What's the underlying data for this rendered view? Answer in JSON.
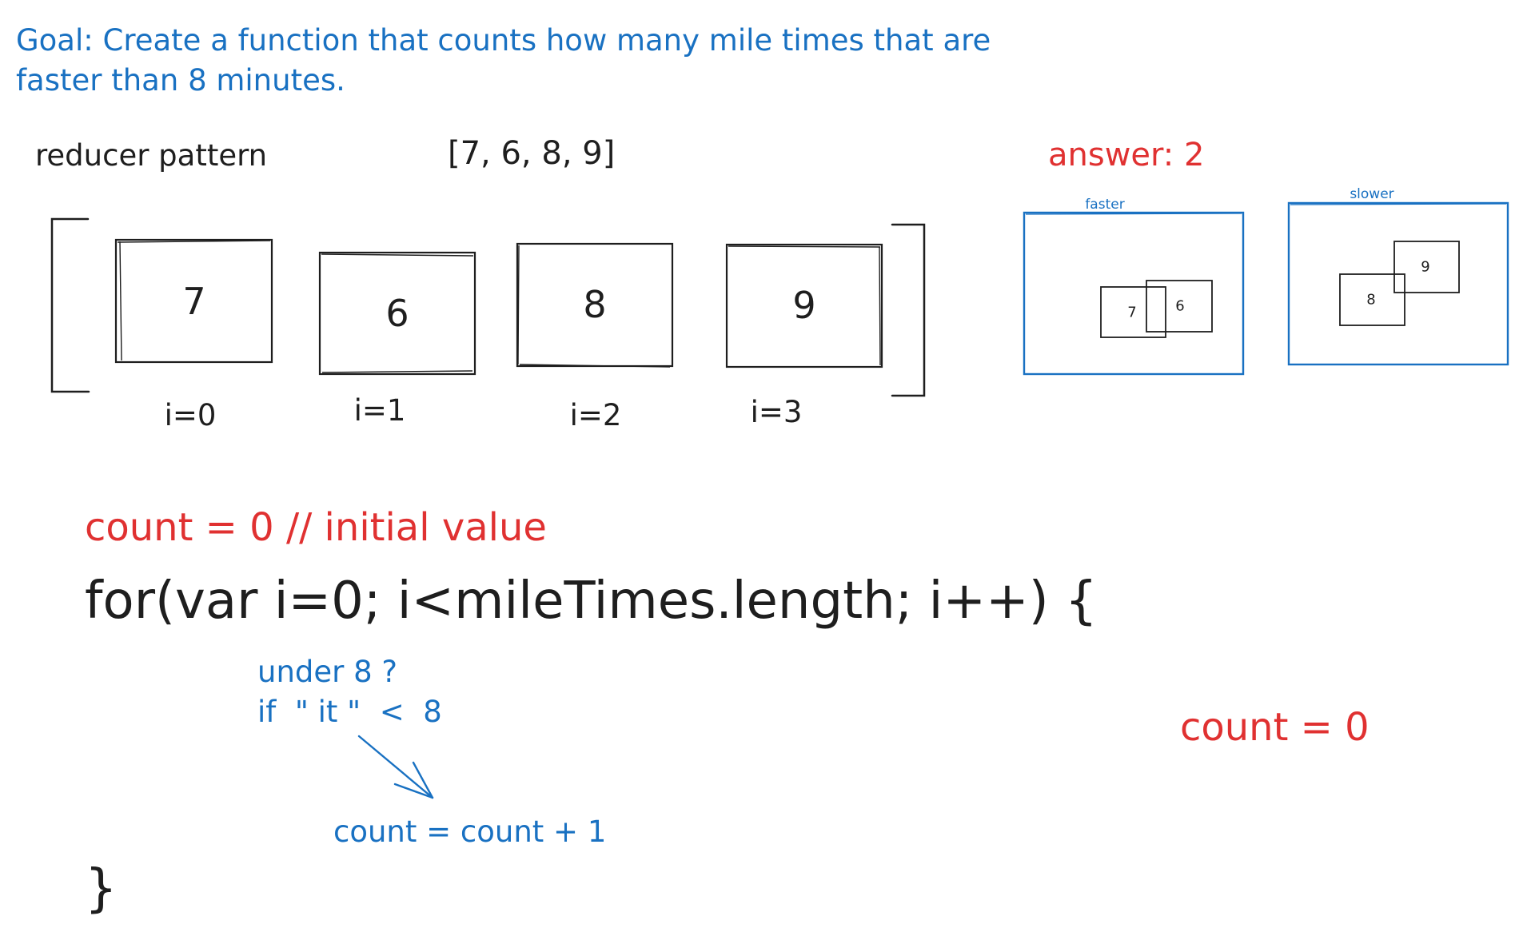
{
  "goal_text": "Goal: Create a function that counts how many mile times that are faster than 8 minutes.",
  "pattern_label": "reducer pattern",
  "array_literal": "[7, 6, 8, 9]",
  "answer_label": "answer: 2",
  "array_items": [
    {
      "value": "7",
      "index_label": "i=0"
    },
    {
      "value": "6",
      "index_label": "i=1"
    },
    {
      "value": "8",
      "index_label": "i=2"
    },
    {
      "value": "9",
      "index_label": "i=3"
    }
  ],
  "groups": {
    "faster": {
      "title": "faster",
      "items": [
        "7",
        "6"
      ]
    },
    "slower": {
      "title": "slower",
      "items": [
        "8",
        "9"
      ]
    }
  },
  "code": {
    "count_init": "count = 0 // initial value",
    "for_loop": "for(var i=0; i<mileTimes.length; i++) {",
    "condition_question": "under 8 ?",
    "condition": "if  \" it \"  <  8",
    "increment": "count = count + 1",
    "closing_brace": "}"
  },
  "count_display": "count = 0",
  "colors": {
    "blue": "#1971c2",
    "red": "#e03131",
    "ink": "#1e1e1e"
  }
}
